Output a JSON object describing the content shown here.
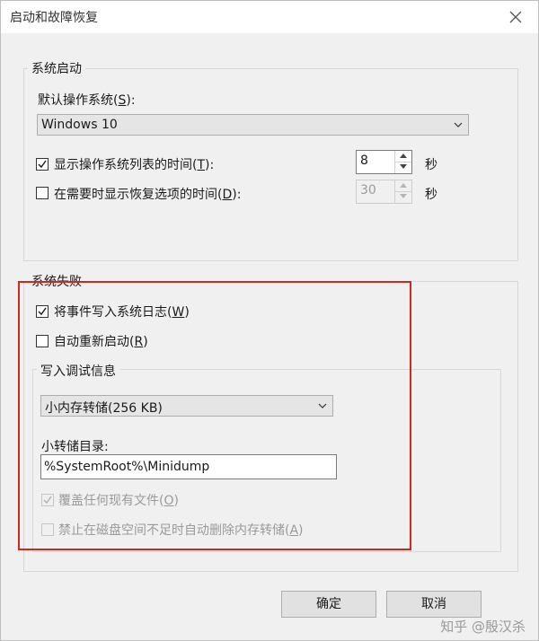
{
  "window": {
    "title": "启动和故障恢复"
  },
  "system_startup": {
    "legend": "系统启动",
    "default_os_label_pre": "默认操作系统(",
    "default_os_label_key": "S",
    "default_os_label_post": "):",
    "default_os_value": "Windows 10",
    "show_list_label_pre": "显示操作系统列表的时间(",
    "show_list_label_key": "T",
    "show_list_label_post": "):",
    "show_list_checked": true,
    "show_list_value": "8",
    "show_list_unit": "秒",
    "show_recovery_label_pre": "在需要时显示恢复选项的时间(",
    "show_recovery_label_key": "D",
    "show_recovery_label_post": "):",
    "show_recovery_checked": false,
    "show_recovery_value": "30",
    "show_recovery_unit": "秒"
  },
  "system_failure": {
    "legend": "系统失败",
    "write_event_label_pre": "将事件写入系统日志(",
    "write_event_label_key": "W",
    "write_event_label_post": ")",
    "write_event_checked": true,
    "auto_restart_label_pre": "自动重新启动(",
    "auto_restart_label_key": "R",
    "auto_restart_label_post": ")",
    "auto_restart_checked": false,
    "debug": {
      "legend": "写入调试信息",
      "dump_type_value": "小内存转储(256 KB)",
      "dir_label": "小转储目录:",
      "dir_value": "%SystemRoot%\\Minidump",
      "overwrite_label_pre": "覆盖任何现有文件(",
      "overwrite_label_key": "O",
      "overwrite_label_post": ")",
      "overwrite_checked": true,
      "disable_autodelete_label_pre": "禁止在磁盘空间不足时自动删除内存转储(",
      "disable_autodelete_label_key": "A",
      "disable_autodelete_label_post": ")",
      "disable_autodelete_checked": false
    }
  },
  "buttons": {
    "ok": "确定",
    "cancel": "取消"
  },
  "watermark": "知乎 @殷汉杀",
  "colors": {
    "highlight_box": "#d0281f",
    "checkbox_check": "#1a1a1a"
  }
}
